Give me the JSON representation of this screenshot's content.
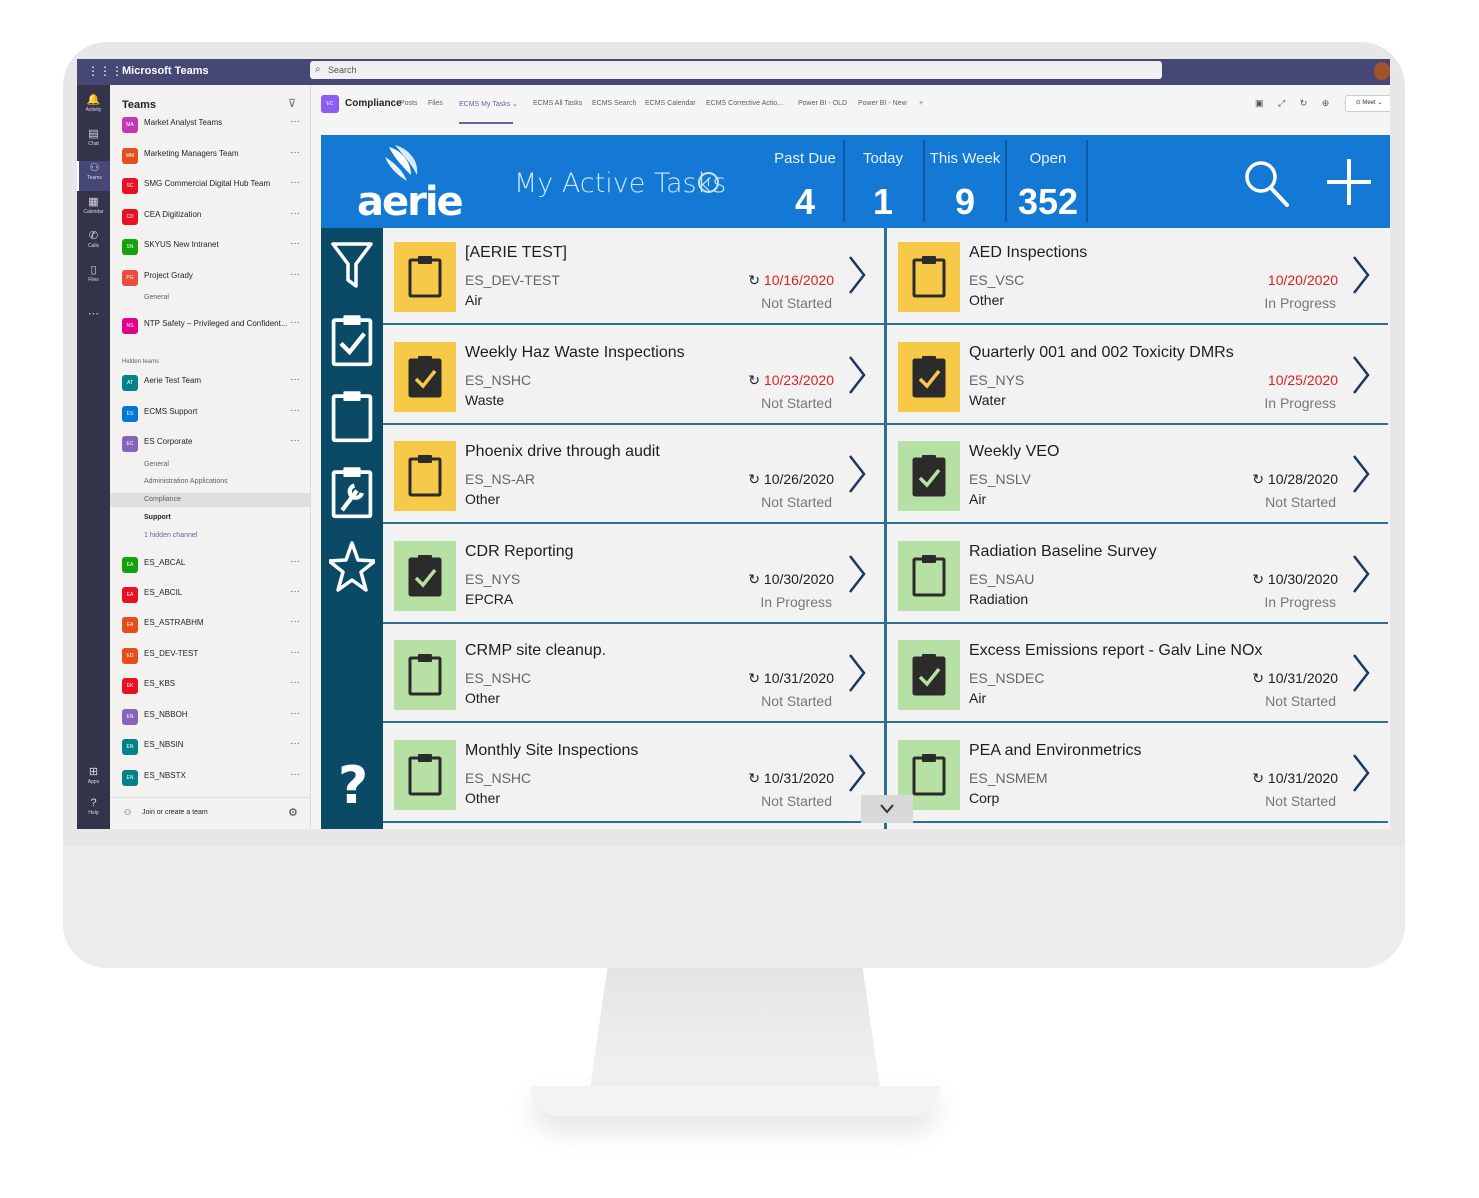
{
  "teams_app": {
    "title": "Microsoft Teams",
    "search_placeholder": "Search",
    "rail": [
      {
        "label": "Activity",
        "icon": "bell-icon"
      },
      {
        "label": "Chat",
        "icon": "chat-icon"
      },
      {
        "label": "Teams",
        "icon": "teams-icon"
      },
      {
        "label": "Calendar",
        "icon": "calendar-icon"
      },
      {
        "label": "Calls",
        "icon": "phone-icon"
      },
      {
        "label": "Files",
        "icon": "file-icon"
      },
      {
        "label": "...",
        "icon": "more-icon"
      },
      {
        "label": "Apps",
        "icon": "apps-icon"
      },
      {
        "label": "Help",
        "icon": "help-icon"
      }
    ]
  },
  "teams_panel": {
    "heading": "Teams",
    "teams": [
      {
        "name": "Market Analyst Teams",
        "abbr": "MA",
        "color": "#c239b3"
      },
      {
        "name": "Marketing Managers Team",
        "abbr": "MM",
        "color": "#e74c1c"
      },
      {
        "name": "SMG Commercial Digital Hub Team",
        "abbr": "SC",
        "color": "#e81123"
      },
      {
        "name": "CEA Digitization",
        "abbr": "CD",
        "color": "#e81123"
      },
      {
        "name": "SKYUS New Intranet",
        "abbr": "SN",
        "color": "#13a10e"
      },
      {
        "name": "Project Grady",
        "abbr": "PG",
        "color": "#e74c3c"
      },
      {
        "name": "NTP Safety – Privileged and Confident...",
        "abbr": "NS",
        "color": "#e3008c"
      }
    ],
    "project_grady_channel": "General",
    "hidden_label": "Hidden teams",
    "hidden_teams": [
      {
        "name": "Aerie Test Team",
        "abbr": "AT",
        "color": "#038387"
      },
      {
        "name": "ECMS Support",
        "abbr": "ES",
        "color": "#0078d4"
      },
      {
        "name": "ES Corporate",
        "abbr": "EC",
        "color": "#8764b8"
      }
    ],
    "corporate_channels": [
      "General",
      "Administration Applications",
      "Compliance",
      "Support",
      "1 hidden channel"
    ],
    "es_teams": [
      {
        "name": "ES_ABCAL",
        "abbr": "EA",
        "color": "#13a10e"
      },
      {
        "name": "ES_ABCIL",
        "abbr": "EA",
        "color": "#e81123"
      },
      {
        "name": "ES_ASTRABHM",
        "abbr": "EA",
        "color": "#e74c1c"
      },
      {
        "name": "ES_DEV-TEST",
        "abbr": "ED",
        "color": "#e74c1c"
      },
      {
        "name": "ES_KBS",
        "abbr": "EK",
        "color": "#e81123"
      },
      {
        "name": "ES_NBBOH",
        "abbr": "EN",
        "color": "#8764b8"
      },
      {
        "name": "ES_NBSIN",
        "abbr": "EN",
        "color": "#038387"
      },
      {
        "name": "ES_NBSTX",
        "abbr": "EN",
        "color": "#038387"
      }
    ],
    "join_label": "Join or create a team"
  },
  "channel": {
    "abbr": "EC",
    "name": "Compliance",
    "tabs": [
      "Posts",
      "Files",
      "ECMS My Tasks ⌄",
      "ECMS All Tasks",
      "ECMS Search",
      "ECMS Calendar",
      "ECMS Corrective Actio...",
      "Power BI - OLD",
      "Power BI - New",
      "+"
    ],
    "meet_label": "Meet"
  },
  "app": {
    "logo_text": "aerie",
    "title": "My Active Tasks",
    "stats": [
      {
        "label": "Past Due",
        "value": "4"
      },
      {
        "label": "Today",
        "value": "1"
      },
      {
        "label": "This Week",
        "value": "9"
      },
      {
        "label": "Open",
        "value": "352"
      }
    ],
    "help_mark": "?",
    "colors": {
      "header": "#1479d4",
      "nav": "#0b4a67",
      "overdue": "#e02020",
      "icon_yellow": "#f7c948",
      "icon_green": "#b7e0a5"
    },
    "tasks": [
      {
        "title": "[AERIE TEST]",
        "site": "ES_DEV-TEST",
        "category": "Air",
        "date": "10/16/2020",
        "recurring": true,
        "overdue": true,
        "status": "Not Started",
        "icon_bg": "yellow",
        "icon": "clipboard-icon"
      },
      {
        "title": "AED Inspections",
        "site": "ES_VSC",
        "category": "Other",
        "date": "10/20/2020",
        "recurring": false,
        "overdue": true,
        "status": "In Progress",
        "icon_bg": "yellow",
        "icon": "clipboard-icon"
      },
      {
        "title": "Weekly Haz Waste Inspections",
        "site": "ES_NSHC",
        "category": "Waste",
        "date": "10/23/2020",
        "recurring": true,
        "overdue": true,
        "status": "Not Started",
        "icon_bg": "yellow",
        "icon": "clipboard-check-icon"
      },
      {
        "title": "Quarterly  001 and 002 Toxicity DMRs",
        "site": "ES_NYS",
        "category": "Water",
        "date": "10/25/2020",
        "recurring": false,
        "overdue": true,
        "status": "In Progress",
        "icon_bg": "yellow",
        "icon": "clipboard-check-icon"
      },
      {
        "title": "Phoenix drive through audit",
        "site": "ES_NS-AR",
        "category": "Other",
        "date": "10/26/2020",
        "recurring": true,
        "overdue": false,
        "status": "Not Started",
        "icon_bg": "yellow",
        "icon": "clipboard-icon"
      },
      {
        "title": "Weekly VEO",
        "site": "ES_NSLV",
        "category": "Air",
        "date": "10/28/2020",
        "recurring": true,
        "overdue": false,
        "status": "Not Started",
        "icon_bg": "green",
        "icon": "clipboard-check-icon"
      },
      {
        "title": "CDR Reporting",
        "site": "ES_NYS",
        "category": "EPCRA",
        "date": "10/30/2020",
        "recurring": true,
        "overdue": false,
        "status": "In Progress",
        "icon_bg": "green",
        "icon": "clipboard-check-icon"
      },
      {
        "title": "Radiation Baseline Survey",
        "site": "ES_NSAU",
        "category": "Radiation",
        "date": "10/30/2020",
        "recurring": true,
        "overdue": false,
        "status": "In Progress",
        "icon_bg": "green",
        "icon": "clipboard-icon"
      },
      {
        "title": "CRMP site cleanup.",
        "site": "ES_NSHC",
        "category": "Other",
        "date": "10/31/2020",
        "recurring": true,
        "overdue": false,
        "status": "Not Started",
        "icon_bg": "green",
        "icon": "clipboard-icon"
      },
      {
        "title": "Excess Emissions report - Galv Line NOx",
        "site": "ES_NSDEC",
        "category": "Air",
        "date": "10/31/2020",
        "recurring": true,
        "overdue": false,
        "status": "Not Started",
        "icon_bg": "green",
        "icon": "clipboard-check-icon"
      },
      {
        "title": "Monthly Site Inspections",
        "site": "ES_NSHC",
        "category": "Other",
        "date": "10/31/2020",
        "recurring": true,
        "overdue": false,
        "status": "Not Started",
        "icon_bg": "green",
        "icon": "clipboard-icon"
      },
      {
        "title": "PEA and Environmetrics",
        "site": "ES_NSMEM",
        "category": "Corp",
        "date": "10/31/2020",
        "recurring": true,
        "overdue": false,
        "status": "Not Started",
        "icon_bg": "green",
        "icon": "clipboard-icon"
      }
    ]
  }
}
